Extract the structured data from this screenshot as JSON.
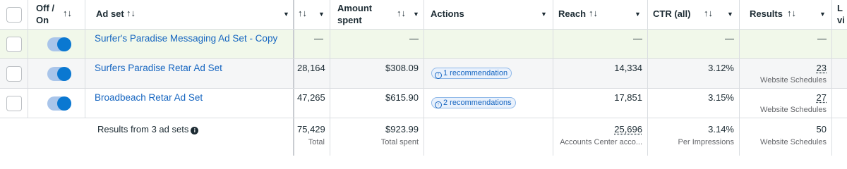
{
  "header": {
    "off_on": "Off /",
    "off_on2": "On",
    "ad_set": "Ad set",
    "amount_spent_1": "Amount",
    "amount_spent_2": "spent",
    "actions": "Actions",
    "reach": "Reach",
    "ctr": "CTR (all)",
    "results": "Results",
    "last_1": "L",
    "last_2": "vi",
    "sort_icon": "↑↓",
    "caret_icon": "▼"
  },
  "rows": [
    {
      "ad_set": "Surfer's Paradise Messaging Ad Set - Copy",
      "impressions": "—",
      "amount_spent": "—",
      "actions": "",
      "reach": "—",
      "ctr": "—",
      "results": "—",
      "results_sub": ""
    },
    {
      "ad_set": "Surfers Paradise Retar Ad Set",
      "impressions": "28,164",
      "amount_spent": "$308.09",
      "actions": "1 recommendation",
      "reach": "14,334",
      "ctr": "3.12%",
      "results": "23",
      "results_sub": "Website Schedules"
    },
    {
      "ad_set": "Broadbeach Retar Ad Set",
      "impressions": "47,265",
      "amount_spent": "$615.90",
      "actions": "2 recommendations",
      "reach": "17,851",
      "ctr": "3.15%",
      "results": "27",
      "results_sub": "Website Schedules"
    }
  ],
  "footer": {
    "label": "Results from 3 ad sets",
    "impressions": "75,429",
    "impressions_sub": "Total",
    "amount_spent": "$923.99",
    "amount_spent_sub": "Total spent",
    "reach": "25,696",
    "reach_sub": "Accounts Center acco...",
    "ctr": "3.14%",
    "ctr_sub": "Per Impressions",
    "results": "50",
    "results_sub": "Website Schedules"
  }
}
